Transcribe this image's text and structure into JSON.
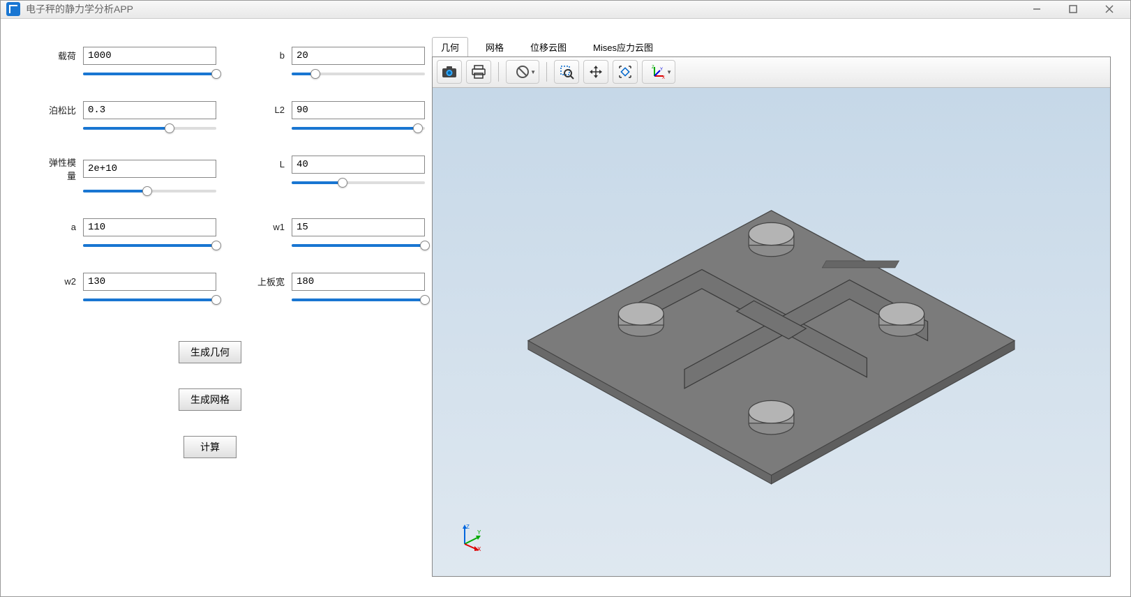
{
  "window": {
    "title": "电子秤的静力学分析APP"
  },
  "params": {
    "left": [
      {
        "label": "载荷",
        "value": "1000",
        "pct": 100
      },
      {
        "label": "泊松比",
        "value": "0.3",
        "pct": 65
      },
      {
        "label": "弹性模量",
        "value": "2e+10",
        "pct": 48
      },
      {
        "label": "a",
        "value": "110",
        "pct": 100
      },
      {
        "label": "w2",
        "value": "130",
        "pct": 100
      }
    ],
    "right": [
      {
        "label": "b",
        "value": "20",
        "pct": 18
      },
      {
        "label": "L2",
        "value": "90",
        "pct": 95
      },
      {
        "label": "L",
        "value": "40",
        "pct": 38
      },
      {
        "label": "w1",
        "value": "15",
        "pct": 100
      },
      {
        "label": "上板宽",
        "value": "180",
        "pct": 100
      }
    ]
  },
  "actions": {
    "gen_geometry": "生成几何",
    "gen_mesh": "生成网格",
    "compute": "计算"
  },
  "tabs": {
    "items": [
      {
        "label": "几何",
        "active": true
      },
      {
        "label": "网格",
        "active": false
      },
      {
        "label": "位移云图",
        "active": false
      },
      {
        "label": "Mises应力云图",
        "active": false
      }
    ]
  },
  "toolbar": {
    "icons": [
      "camera",
      "print",
      "disable",
      "zoom",
      "pan",
      "fit",
      "axes"
    ]
  },
  "axis_labels": {
    "x": "X",
    "y": "Y",
    "z": "Z"
  }
}
